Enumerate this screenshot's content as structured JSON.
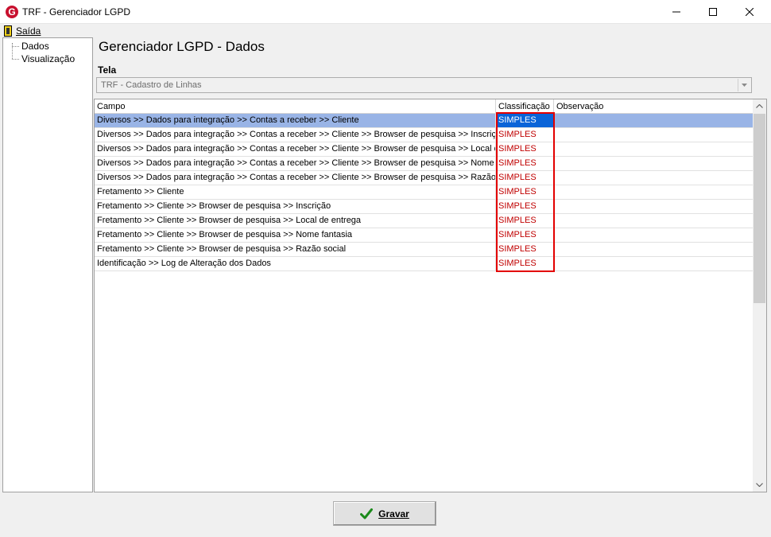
{
  "window": {
    "app_icon_letter": "G",
    "title": "TRF - Gerenciador LGPD",
    "controls": [
      "minimize-icon",
      "maximize-icon",
      "close-icon"
    ]
  },
  "menu": {
    "exit_label": "Saída",
    "exit_icon": "exit-door-icon"
  },
  "tree": {
    "items": [
      {
        "label": "Dados"
      },
      {
        "label": "Visualização"
      }
    ]
  },
  "main": {
    "title": "Gerenciador LGPD - Dados",
    "tela_label": "Tela",
    "tela_value": "TRF - Cadastro de Linhas"
  },
  "grid": {
    "columns": [
      "Campo",
      "Classificação",
      "Observação"
    ],
    "selected_row": 0,
    "rows": [
      {
        "campo": "Diversos >> Dados para integração >> Contas a receber >> Cliente",
        "classificacao": "SIMPLES",
        "observacao": ""
      },
      {
        "campo": "Diversos >> Dados para integração >> Contas a receber >> Cliente >> Browser de pesquisa >> Inscrição",
        "classificacao": "SIMPLES",
        "observacao": ""
      },
      {
        "campo": "Diversos >> Dados para integração >> Contas a receber >> Cliente >> Browser de pesquisa >> Local de...",
        "classificacao": "SIMPLES",
        "observacao": ""
      },
      {
        "campo": "Diversos >> Dados para integração >> Contas a receber >> Cliente >> Browser de pesquisa >> Nome fa...",
        "classificacao": "SIMPLES",
        "observacao": ""
      },
      {
        "campo": "Diversos >> Dados para integração >> Contas a receber >> Cliente >> Browser de pesquisa >> Razão s...",
        "classificacao": "SIMPLES",
        "observacao": ""
      },
      {
        "campo": "Fretamento >> Cliente",
        "classificacao": "SIMPLES",
        "observacao": ""
      },
      {
        "campo": "Fretamento >> Cliente >> Browser de pesquisa >> Inscrição",
        "classificacao": "SIMPLES",
        "observacao": ""
      },
      {
        "campo": "Fretamento >> Cliente >> Browser de pesquisa >> Local de entrega",
        "classificacao": "SIMPLES",
        "observacao": ""
      },
      {
        "campo": "Fretamento >> Cliente >> Browser de pesquisa >> Nome fantasia",
        "classificacao": "SIMPLES",
        "observacao": ""
      },
      {
        "campo": "Fretamento >> Cliente >> Browser de pesquisa >> Razão social",
        "classificacao": "SIMPLES",
        "observacao": ""
      },
      {
        "campo": "Identificação >> Log de Alteração dos Dados",
        "classificacao": "SIMPLES",
        "observacao": ""
      }
    ]
  },
  "footer": {
    "save_label": "Gravar",
    "save_icon": "checkmark-icon"
  },
  "colors": {
    "classification_text": "#c00000",
    "highlight_box": "#e30000",
    "selected_row": "#99b4e6",
    "selected_cell": "#0a64d8"
  }
}
